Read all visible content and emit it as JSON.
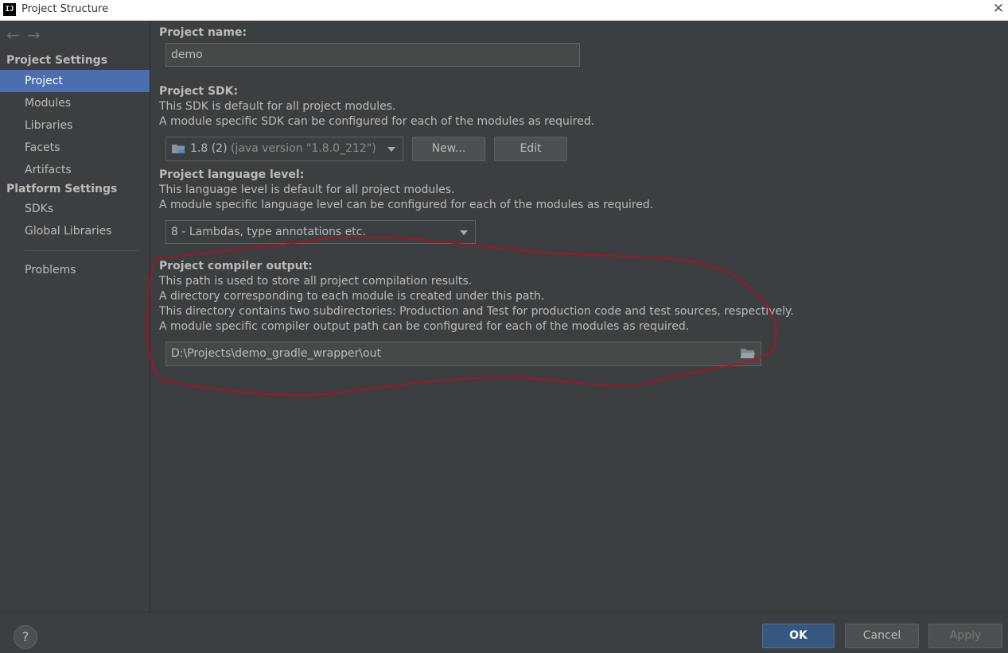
{
  "window": {
    "title": "Project Structure",
    "app_icon_text": "IJ"
  },
  "sidebar": {
    "project_settings_header": "Project Settings",
    "project_items": [
      {
        "label": "Project"
      },
      {
        "label": "Modules"
      },
      {
        "label": "Libraries"
      },
      {
        "label": "Facets"
      },
      {
        "label": "Artifacts"
      }
    ],
    "platform_settings_header": "Platform Settings",
    "platform_items": [
      {
        "label": "SDKs"
      },
      {
        "label": "Global Libraries"
      }
    ],
    "problems_label": "Problems",
    "selected_item": "Project"
  },
  "main": {
    "project_name": {
      "label": "Project name:",
      "value": "demo"
    },
    "project_sdk": {
      "label": "Project SDK:",
      "desc1": "This SDK is default for all project modules.",
      "desc2": "A module specific SDK can be configured for each of the modules as required.",
      "value": "1.8 (2)",
      "detail": "(java version \"1.8.0_212\")",
      "new_button": "New...",
      "edit_button": "Edit"
    },
    "language_level": {
      "label": "Project language level:",
      "desc1": "This language level is default for all project modules.",
      "desc2": "A module specific language level can be configured for each of the modules as required.",
      "value": "8 - Lambdas, type annotations etc."
    },
    "compiler_output": {
      "label": "Project compiler output:",
      "desc1": "This path is used to store all project compilation results.",
      "desc2": "A directory corresponding to each module is created under this path.",
      "desc3": "This directory contains two subdirectories: Production and Test for production code and test sources, respectively.",
      "desc4": "A module specific compiler output path can be configured for each of the modules as required.",
      "value": "D:\\Projects\\demo_gradle_wrapper\\out"
    }
  },
  "footer": {
    "help_label": "?",
    "ok_label": "OK",
    "cancel_label": "Cancel",
    "apply_label": "Apply"
  },
  "colors": {
    "background": "#3c3f41",
    "selection": "#4b6eaf",
    "ok_button": "#365880",
    "annotation": "#d0021b"
  }
}
